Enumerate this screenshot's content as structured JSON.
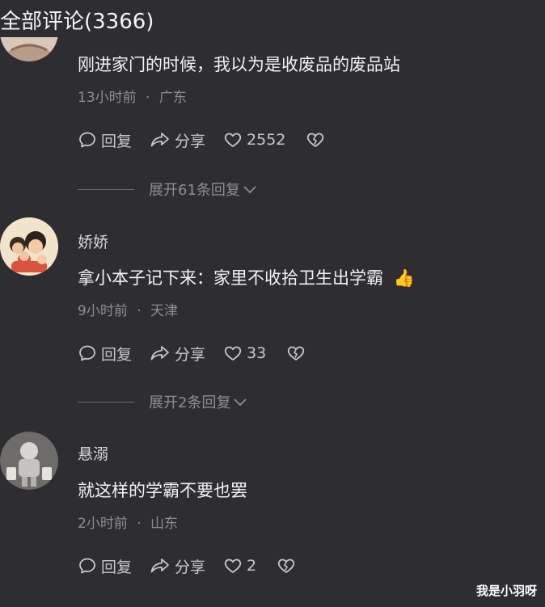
{
  "header": {
    "title": "全部评论(3366)"
  },
  "comments": [
    {
      "username": "",
      "content": "刚进家门的时候，我以为是收废品的废品站",
      "time": "13小时前",
      "location": "广东",
      "reply_label": "回复",
      "share_label": "分享",
      "likes": "2552",
      "expand_label": "展开61条回复"
    },
    {
      "username": "娇娇",
      "content": "拿小本子记下来：家里不收拾卫生出学霸",
      "emoji": "👍",
      "time": "9小时前",
      "location": "天津",
      "reply_label": "回复",
      "share_label": "分享",
      "likes": "33",
      "expand_label": "展开2条回复"
    },
    {
      "username": "悬溺",
      "content": "就这样的学霸不要也罢",
      "time": "2小时前",
      "location": "山东",
      "reply_label": "回复",
      "share_label": "分享",
      "likes": "2"
    }
  ],
  "meta_separator": "·",
  "watermark": "我是小羽呀",
  "icons": {
    "reply": "comment-bubble-icon",
    "share": "share-arrow-icon",
    "like": "heart-icon",
    "dislike": "broken-heart-icon",
    "expand": "chevron-down-icon"
  }
}
